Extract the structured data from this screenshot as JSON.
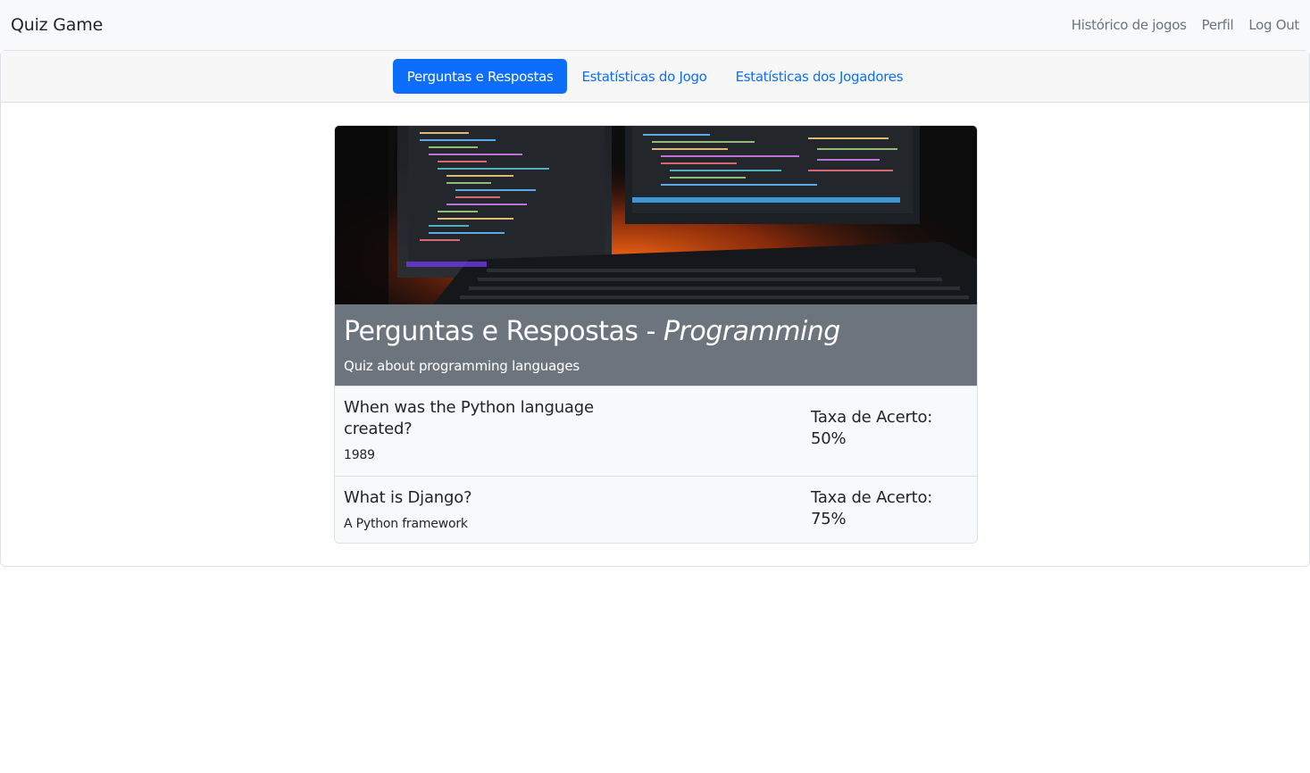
{
  "navbar": {
    "brand": "Quiz Game",
    "links": [
      "Histórico de jogos",
      "Perfil",
      "Log Out"
    ]
  },
  "tabs": [
    {
      "label": "Perguntas e Respostas",
      "active": true
    },
    {
      "label": "Estatísticas do Jogo",
      "active": false
    },
    {
      "label": "Estatísticas dos Jogadores",
      "active": false
    }
  ],
  "quiz": {
    "title_prefix": "Perguntas e Respostas - ",
    "title_topic": "Programming",
    "description": "Quiz about programming languages",
    "questions": [
      {
        "question": "When was the Python language created?",
        "answer": "1989",
        "rate_label": "Taxa de Acerto: 50%"
      },
      {
        "question": "What is Django?",
        "answer": "A Python framework",
        "rate_label": "Taxa de Acerto: 75%"
      }
    ]
  },
  "colors": {
    "primary": "#0d6efd",
    "secondary": "#6c757d",
    "navbar_bg": "#f8f9fa"
  }
}
